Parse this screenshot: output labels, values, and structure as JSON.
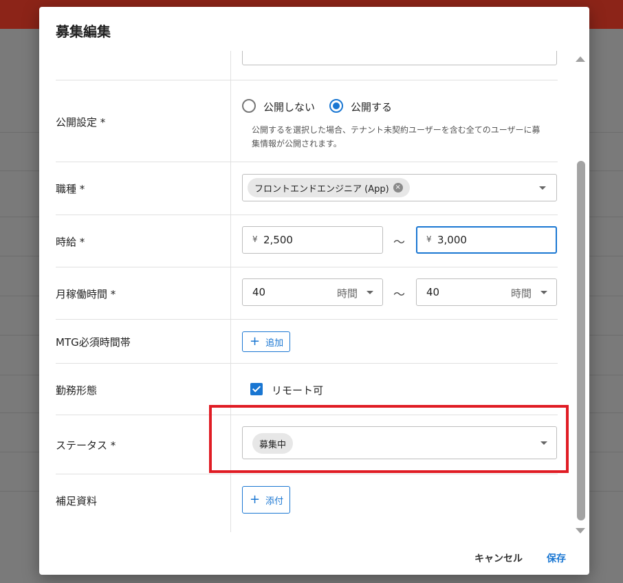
{
  "dialog": {
    "title": "募集編集"
  },
  "form": {
    "publish": {
      "label": "公開設定 *",
      "options": [
        {
          "label": "公開しない",
          "selected": false
        },
        {
          "label": "公開する",
          "selected": true
        }
      ],
      "helper_line1": "公開するを選択した場合、テナント未契約ユーザーを含む全てのユーザーに募",
      "helper_line2": "集情報が公開されます。"
    },
    "job_type": {
      "label": "職種 *",
      "chip": "フロントエンドエンジニア (App)"
    },
    "hourly_wage": {
      "label": "時給 *",
      "currency": "¥",
      "min_value": "2,500",
      "max_value": "3,000",
      "separator": "〜"
    },
    "monthly_hours": {
      "label": "月稼働時間 *",
      "min_value": "40",
      "max_value": "40",
      "unit": "時間",
      "separator": "〜"
    },
    "mtg_time": {
      "label": "MTG必須時間帯",
      "button": "追加"
    },
    "work_style": {
      "label": "勤務形態",
      "checkbox_label": "リモート可",
      "checked": true
    },
    "status": {
      "label": "ステータス *",
      "chip": "募集中"
    },
    "attachments": {
      "label": "補足資料",
      "button": "添付"
    }
  },
  "actions": {
    "cancel": "キャンセル",
    "save": "保存"
  },
  "colors": {
    "accent": "#1976d2",
    "highlight": "#e01c24",
    "app_bar": "#8c2418"
  },
  "icons": {
    "plus": "+",
    "clear": "×"
  }
}
